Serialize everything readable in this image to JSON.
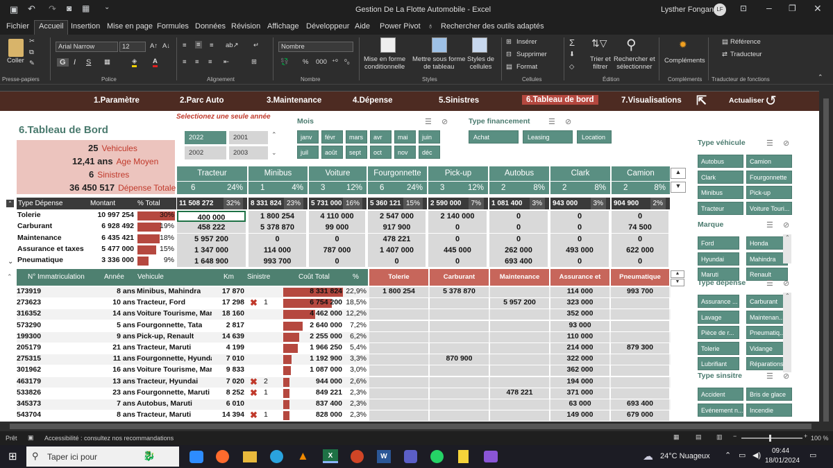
{
  "window": {
    "title": "Gestion De La Flotte Automobile  -  Excel",
    "user": "Lysther Fongang",
    "user_initials": "LF"
  },
  "tabs": [
    "Fichier",
    "Accueil",
    "Insertion",
    "Mise en page",
    "Formules",
    "Données",
    "Révision",
    "Affichage",
    "Développeur",
    "Aide",
    "Power Pivot",
    "Rechercher des outils adaptés"
  ],
  "ribbon": {
    "font": "Arial Narrow",
    "size": "12",
    "number_format": "Nombre",
    "groups": [
      "Presse-papiers",
      "Police",
      "Alignement",
      "Nombre",
      "Styles",
      "Cellules",
      "Édition",
      "Compléments",
      "Traducteur de fonctions"
    ],
    "labels": {
      "coller": "Coller",
      "cond": "Mise en forme\nconditionnelle",
      "table": "Mettre sous forme\nde tableau",
      "styles": "Styles de\ncellules",
      "inserer": "Insérer",
      "supprimer": "Supprimer",
      "format": "Format",
      "trier": "Trier et\nfiltrer",
      "rechercher": "Rechercher et\nsélectionner",
      "complements": "Compléments",
      "reference": "Référence",
      "traducteur": "Traducteur"
    }
  },
  "nav": [
    "1.Paramètre",
    "2.Parc Auto",
    "3.Maintenance",
    "4.Dépense",
    "5.Sinistres",
    "6.Tableau de bord",
    "7.Visualisations",
    "Actualiser"
  ],
  "dashboard": {
    "title": "6.Tableau de Bord",
    "hint": "Selectionez une seule année",
    "kpis": [
      {
        "value": "25",
        "label": "Vehicules"
      },
      {
        "value": "12,41 ans",
        "label": "Age Moyen"
      },
      {
        "value": "6",
        "label": "Sinistres"
      },
      {
        "value": "36 450 517",
        "label": "Dépense Totale"
      }
    ],
    "years": [
      "2022",
      "2001",
      "2002",
      "2003"
    ],
    "mois_title": "Mois",
    "mois": [
      "janv",
      "févr",
      "mars",
      "avr",
      "mai",
      "juin",
      "juil",
      "août",
      "sept",
      "oct",
      "nov",
      "déc"
    ],
    "fin_title": "Type financement",
    "financement": [
      "Achat",
      "Leasing",
      "Location"
    ],
    "types": [
      {
        "name": "Tracteur",
        "count": "6",
        "pct": "24%",
        "total": "11 508 272",
        "tpct": "32%"
      },
      {
        "name": "Minibus",
        "count": "1",
        "pct": "4%",
        "total": "8 331 824",
        "tpct": "23%"
      },
      {
        "name": "Voiture Tourisme",
        "count": "3",
        "pct": "12%",
        "total": "5 731 000",
        "tpct": "16%"
      },
      {
        "name": "Fourgonnette",
        "count": "6",
        "pct": "24%",
        "total": "5 360 121",
        "tpct": "15%"
      },
      {
        "name": "Pick-up",
        "count": "3",
        "pct": "12%",
        "total": "2 590 000",
        "tpct": "7%"
      },
      {
        "name": "Autobus",
        "count": "2",
        "pct": "8%",
        "total": "1 081 400",
        "tpct": "3%"
      },
      {
        "name": "Clark",
        "count": "2",
        "pct": "8%",
        "total": "943 000",
        "tpct": "3%"
      },
      {
        "name": "Camion",
        "count": "2",
        "pct": "8%",
        "total": "904 900",
        "tpct": "2%"
      }
    ],
    "dep_headers": [
      "Type Dépense",
      "Montant",
      "% Total"
    ],
    "depenses": [
      {
        "name": "Tolerie",
        "montant": "10 997 254",
        "pct": "30%",
        "frac": 0.3,
        "vals": [
          "400 000",
          "1 800 254",
          "4 110 000",
          "2 547 000",
          "2 140 000",
          "0",
          "0",
          "0"
        ]
      },
      {
        "name": "Carburant",
        "montant": "6 928 492",
        "pct": "19%",
        "frac": 0.19,
        "vals": [
          "458 222",
          "5 378 870",
          "99 000",
          "917 900",
          "0",
          "0",
          "0",
          "74 500"
        ]
      },
      {
        "name": "Maintenance",
        "montant": "6 435 421",
        "pct": "18%",
        "frac": 0.18,
        "vals": [
          "5 957 200",
          "0",
          "0",
          "478 221",
          "0",
          "0",
          "0",
          "0"
        ]
      },
      {
        "name": "Assurance et taxes",
        "montant": "5 477 000",
        "pct": "15%",
        "frac": 0.15,
        "vals": [
          "1 347 000",
          "114 000",
          "787 000",
          "1 407 000",
          "445 000",
          "262 000",
          "493 000",
          "622 000"
        ]
      },
      {
        "name": "Pneumatique",
        "montant": "3 336 000",
        "pct": "9%",
        "frac": 0.09,
        "vals": [
          "1 648 900",
          "993 700",
          "0",
          "0",
          "0",
          "693 400",
          "0",
          "0"
        ]
      }
    ],
    "veh_headers": [
      "N° Immatriculation",
      "Année",
      "Vehicule",
      "Km",
      "Sinistre",
      "Coût Total",
      "%",
      "Tolerie",
      "Carburant",
      "Maintenance",
      "Assurance et taxes",
      "Pneumatique"
    ],
    "vehicles": [
      {
        "immat": "173919",
        "age": "8 ans",
        "veh": "Minibus, Mahindra",
        "km": "17 870",
        "sin": "",
        "cout": "8 331 824",
        "pct": "22,9%",
        "frac": 1.0,
        "tol": "1 800 254",
        "car": "5 378 870",
        "mai": "",
        "ass": "114 000",
        "pne": "993 700"
      },
      {
        "immat": "273623",
        "age": "10 ans",
        "veh": "Tracteur, Ford",
        "km": "17 298",
        "sin": "1",
        "cout": "6 754 200",
        "pct": "18,5%",
        "frac": 0.81,
        "tol": "",
        "car": "",
        "mai": "5 957 200",
        "ass": "323 000",
        "pne": ""
      },
      {
        "immat": "316352",
        "age": "14 ans",
        "veh": "Voiture Tourisme, Marut",
        "km": "18 160",
        "sin": "",
        "cout": "4 462 000",
        "pct": "12,2%",
        "frac": 0.54,
        "tol": "",
        "car": "",
        "mai": "",
        "ass": "352 000",
        "pne": ""
      },
      {
        "immat": "573290",
        "age": "5 ans",
        "veh": "Fourgonnette, Tata",
        "km": "2 817",
        "sin": "",
        "cout": "2 640 000",
        "pct": "7,2%",
        "frac": 0.32,
        "tol": "",
        "car": "",
        "mai": "",
        "ass": "93 000",
        "pne": ""
      },
      {
        "immat": "199300",
        "age": "9 ans",
        "veh": "Pick-up, Renault",
        "km": "14 639",
        "sin": "",
        "cout": "2 255 000",
        "pct": "6,2%",
        "frac": 0.27,
        "tol": "",
        "car": "",
        "mai": "",
        "ass": "110 000",
        "pne": ""
      },
      {
        "immat": "205179",
        "age": "21 ans",
        "veh": "Tracteur, Maruti",
        "km": "4 199",
        "sin": "",
        "cout": "1 966 250",
        "pct": "5,4%",
        "frac": 0.24,
        "tol": "",
        "car": "",
        "mai": "",
        "ass": "214 000",
        "pne": "879 300"
      },
      {
        "immat": "275315",
        "age": "11 ans",
        "veh": "Fourgonnette, Hyundai",
        "km": "7 010",
        "sin": "",
        "cout": "1 192 900",
        "pct": "3,3%",
        "frac": 0.14,
        "tol": "",
        "car": "870 900",
        "mai": "",
        "ass": "322 000",
        "pne": ""
      },
      {
        "immat": "301962",
        "age": "16 ans",
        "veh": "Voiture Tourisme, Marut",
        "km": "9 833",
        "sin": "",
        "cout": "1 087 000",
        "pct": "3,0%",
        "frac": 0.13,
        "tol": "",
        "car": "",
        "mai": "",
        "ass": "362 000",
        "pne": ""
      },
      {
        "immat": "463179",
        "age": "13 ans",
        "veh": "Tracteur, Hyundai",
        "km": "7 020",
        "sin": "2",
        "cout": "944 000",
        "pct": "2,6%",
        "frac": 0.11,
        "tol": "",
        "car": "",
        "mai": "",
        "ass": "194 000",
        "pne": ""
      },
      {
        "immat": "533826",
        "age": "23 ans",
        "veh": "Fourgonnette, Maruti",
        "km": "8 252",
        "sin": "1",
        "cout": "849 221",
        "pct": "2,3%",
        "frac": 0.1,
        "tol": "",
        "car": "",
        "mai": "478 221",
        "ass": "371 000",
        "pne": ""
      },
      {
        "immat": "345373",
        "age": "7 ans",
        "veh": "Autobus, Maruti",
        "km": "6 010",
        "sin": "",
        "cout": "837 400",
        "pct": "2,3%",
        "frac": 0.1,
        "tol": "",
        "car": "",
        "mai": "",
        "ass": "63 000",
        "pne": "693 400"
      },
      {
        "immat": "543704",
        "age": "8 ans",
        "veh": "Tracteur, Maruti",
        "km": "14 394",
        "sin": "1",
        "cout": "828 000",
        "pct": "2,3%",
        "frac": 0.1,
        "tol": "",
        "car": "",
        "mai": "",
        "ass": "149 000",
        "pne": "679 000"
      }
    ]
  },
  "slicers": [
    {
      "title": "Type véhicule",
      "items": [
        "Autobus",
        "Camion",
        "Clark",
        "Fourgonnette",
        "Minibus",
        "Pick-up",
        "Tracteur",
        "Voiture Touri..."
      ]
    },
    {
      "title": "Marque",
      "items": [
        "Ford",
        "Honda",
        "Hyundai",
        "Mahindra",
        "Maruti",
        "Renault"
      ]
    },
    {
      "title": "Type dépense",
      "items": [
        "Assurance ...",
        "Carburant",
        "Lavage",
        "Maintenan...",
        "Pièce de r...",
        "Pneumatiq...",
        "Tolerie",
        "Vidange",
        "Lubrifiant",
        "Réparations"
      ]
    },
    {
      "title": "Type sinsitre",
      "items": [
        "Accident",
        "Bris de glace",
        "Evénement n...",
        "Incendie"
      ]
    }
  ],
  "status": {
    "ready": "Prêt",
    "access": "Accessibilité : consultez nos recommandations",
    "zoom": "100 %"
  },
  "taskbar": {
    "search": "Taper ici pour",
    "weather": "24°C  Nuageux",
    "time": "09:44",
    "date": "18/01/2024"
  }
}
